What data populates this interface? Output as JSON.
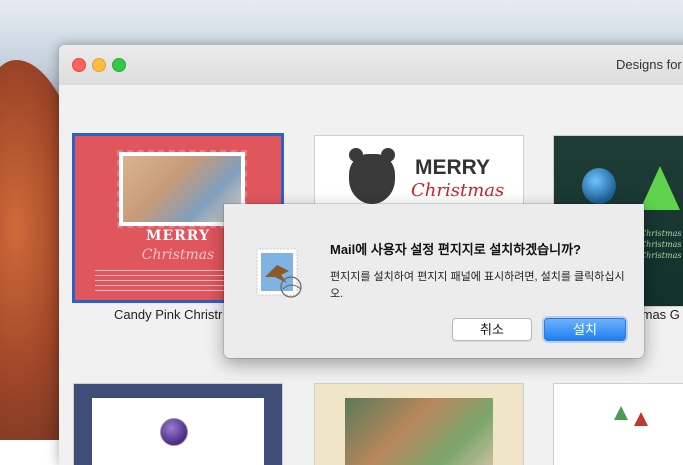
{
  "window": {
    "title": "Designs for"
  },
  "cards": [
    {
      "label": "Candy Pink Christr",
      "merry": "MERRY",
      "christmas": "Christmas"
    },
    {
      "label": "",
      "merry": "MERRY",
      "christmas": "Christmas"
    },
    {
      "label": "tmas G",
      "text": "Christmas Christmas Christmas"
    }
  ],
  "dialog": {
    "title": "Mail에 사용자 설정 편지지로 설치하겠습니까?",
    "message": "편지지를 설치하여 편지지 패널에 표시하려면, 설치를 클릭하십시오.",
    "cancel_label": "취소",
    "install_label": "설치",
    "icon": "mail-stamp-icon"
  },
  "colors": {
    "accent": "#1e7ef5",
    "selection": "#2a62c9",
    "candy_pink": "#e0565c"
  }
}
